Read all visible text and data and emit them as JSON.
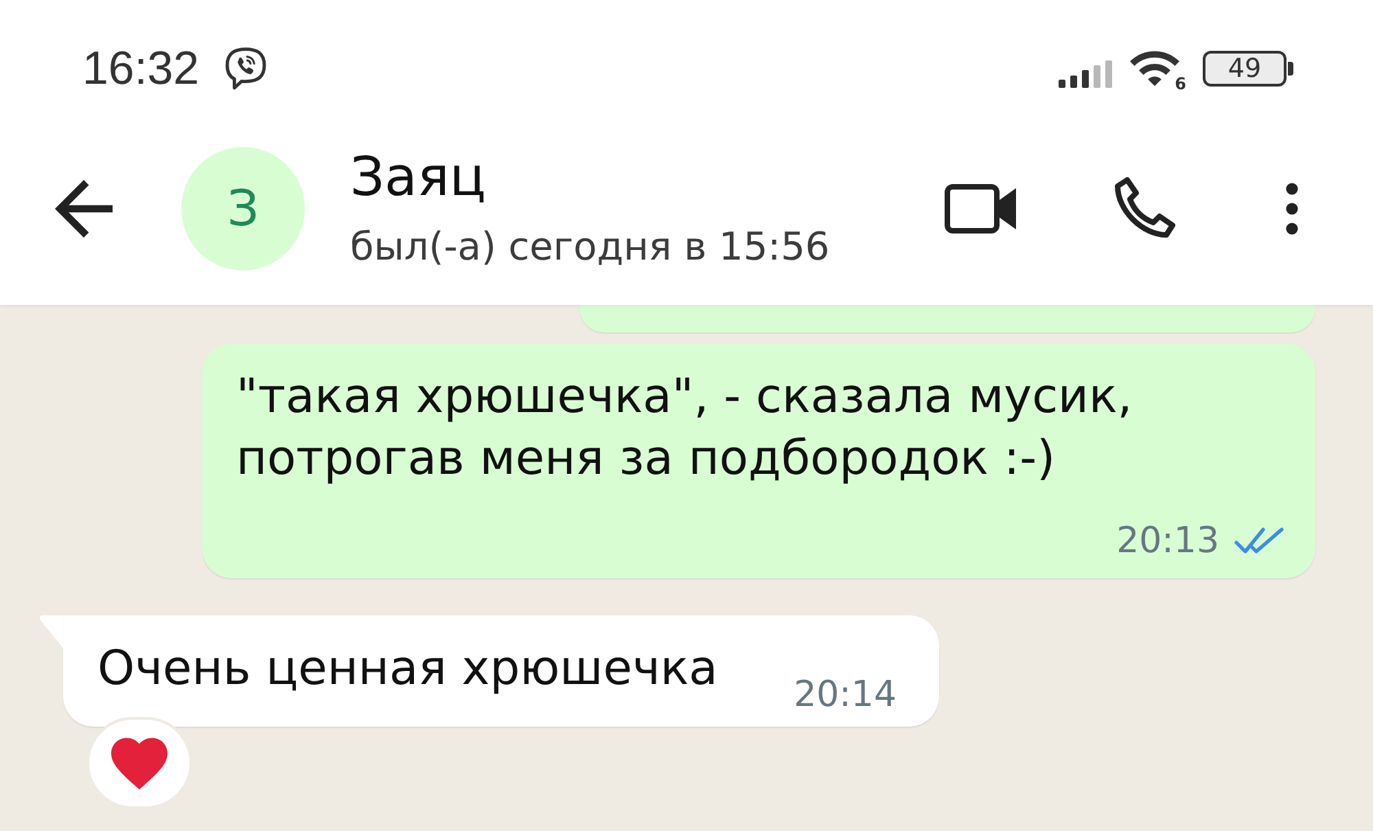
{
  "status_bar": {
    "time": "16:32",
    "wifi_label": "6",
    "battery": "49"
  },
  "header": {
    "avatar_letter": "З",
    "name": "Заяц",
    "last_seen": "был(-а) сегодня в 15:56"
  },
  "messages": [
    {
      "outgoing": true,
      "cut_off": true
    },
    {
      "outgoing": true,
      "cut_off": false,
      "tail": false,
      "text": "\"такая хрюшечка\", - сказала мусик, потрогав меня за подбородок :-)",
      "time": "20:13",
      "read": true,
      "reaction": false
    },
    {
      "outgoing": false,
      "cut_off": false,
      "tail": true,
      "text": "Очень ценная хрюшечка",
      "time": "20:14",
      "reaction": true
    }
  ]
}
